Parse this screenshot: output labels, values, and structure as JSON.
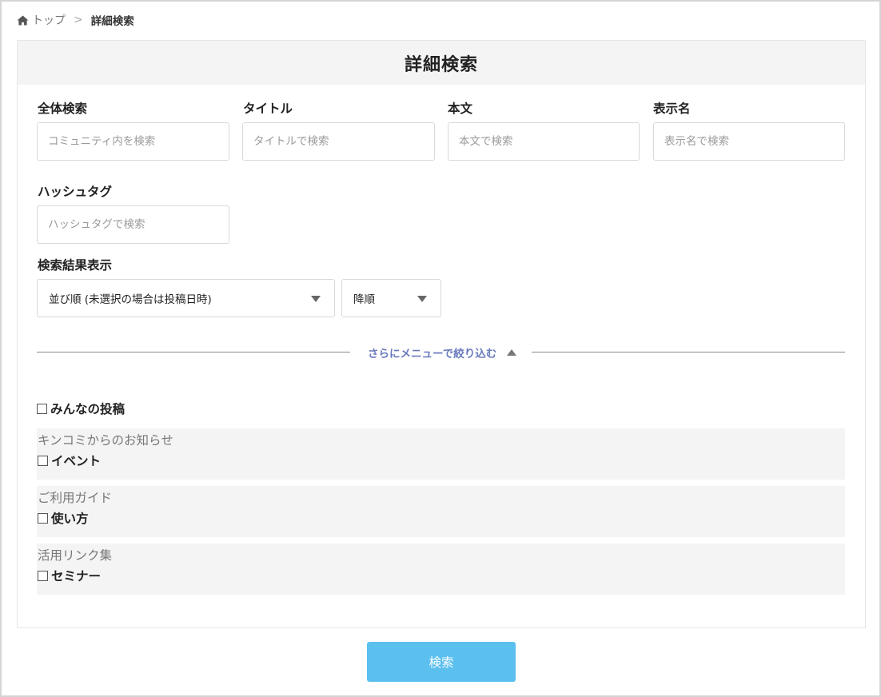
{
  "breadcrumb": {
    "home": "トップ",
    "separator": ">",
    "current": "詳細検索"
  },
  "panel": {
    "title": "詳細検索"
  },
  "fields": {
    "all": {
      "label": "全体検索",
      "placeholder": "コミュニティ内を検索"
    },
    "title": {
      "label": "タイトル",
      "placeholder": "タイトルで検索"
    },
    "body": {
      "label": "本文",
      "placeholder": "本文で検索"
    },
    "display_name": {
      "label": "表示名",
      "placeholder": "表示名で検索"
    },
    "hashtag": {
      "label": "ハッシュタグ",
      "placeholder": "ハッシュタグで検索"
    }
  },
  "results": {
    "label": "検索結果表示",
    "sort_select": {
      "value": "並び順 (未選択の場合は投稿日時)"
    },
    "order_select": {
      "value": "降順"
    }
  },
  "narrow": {
    "label": "さらにメニューで絞り込む"
  },
  "categories": {
    "everyone": {
      "label": "みんなの投稿"
    },
    "groups": [
      {
        "title": "キンコミからのお知らせ",
        "item": "イベント"
      },
      {
        "title": "ご利用ガイド",
        "item": "使い方"
      },
      {
        "title": "活用リンク集",
        "item": "セミナー"
      }
    ]
  },
  "search_button": {
    "label": "検索"
  },
  "colors": {
    "accent": "#5bc0ee",
    "link": "#6a7bbd",
    "panel_header": "#f4f4f4"
  },
  "icons": {
    "home": "home-icon",
    "sort_caret": "caret-down-icon",
    "collapse": "triangle-up-icon"
  }
}
